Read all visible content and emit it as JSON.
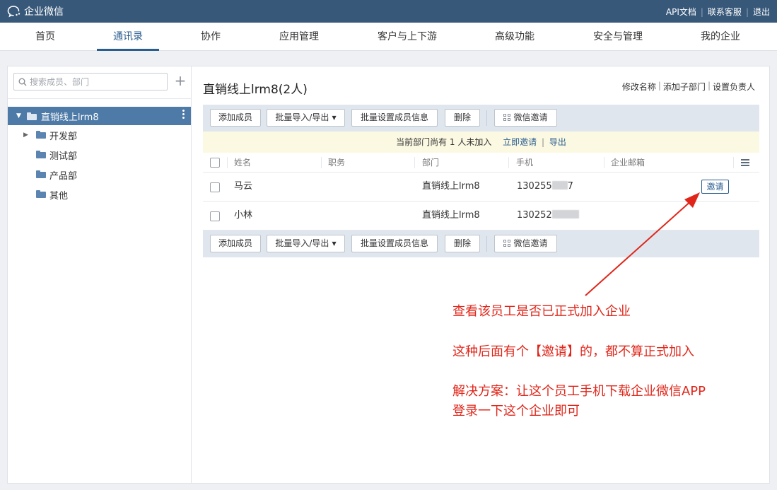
{
  "topbar": {
    "logo_text": "企业微信",
    "links": [
      "API文档",
      "联系客服",
      "退出"
    ],
    "separator": "|"
  },
  "nav": {
    "items": [
      "首页",
      "通讯录",
      "协作",
      "应用管理",
      "客户与上下游",
      "高级功能",
      "安全与管理",
      "我的企业"
    ],
    "active": "通讯录"
  },
  "sidebar": {
    "search_placeholder": "搜索成员、部门",
    "add_icon": "plus-icon",
    "tree": {
      "root": "直销线上lrm8",
      "children": [
        "开发部",
        "测试部",
        "产品部",
        "其他"
      ]
    }
  },
  "main": {
    "title": "直销线上lrm8(2人)",
    "header_links": [
      "修改名称",
      "添加子部门",
      "设置负责人"
    ],
    "toolbar": {
      "add_member": "添加成员",
      "batch_import_export": "批量导入/导出",
      "batch_set": "批量设置成员信息",
      "delete": "删除",
      "wechat_invite": "微信邀请"
    },
    "notice": {
      "text": "当前部门尚有 1 人未加入",
      "invite_now": "立即邀请",
      "export": "导出"
    },
    "table": {
      "columns": [
        "姓名",
        "职务",
        "部门",
        "手机",
        "企业邮箱"
      ],
      "rows": [
        {
          "name": "马云",
          "title": "",
          "dept": "直销线上lrm8",
          "phone": "130255",
          "phone_tail": "7",
          "email": "",
          "action": "邀请"
        },
        {
          "name": "小林",
          "title": "",
          "dept": "直销线上lrm8",
          "phone": "130252",
          "phone_tail": "",
          "email": "",
          "action": ""
        }
      ]
    }
  },
  "annotation": {
    "color": "#e0261a",
    "line1": "查看该员工是否已正式加入企业",
    "line2": "这种后面有个【邀请】的，都不算正式加入",
    "line3": "解决方案：让这个员工手机下载企业微信APP",
    "line4": "登录一下这个企业即可"
  }
}
